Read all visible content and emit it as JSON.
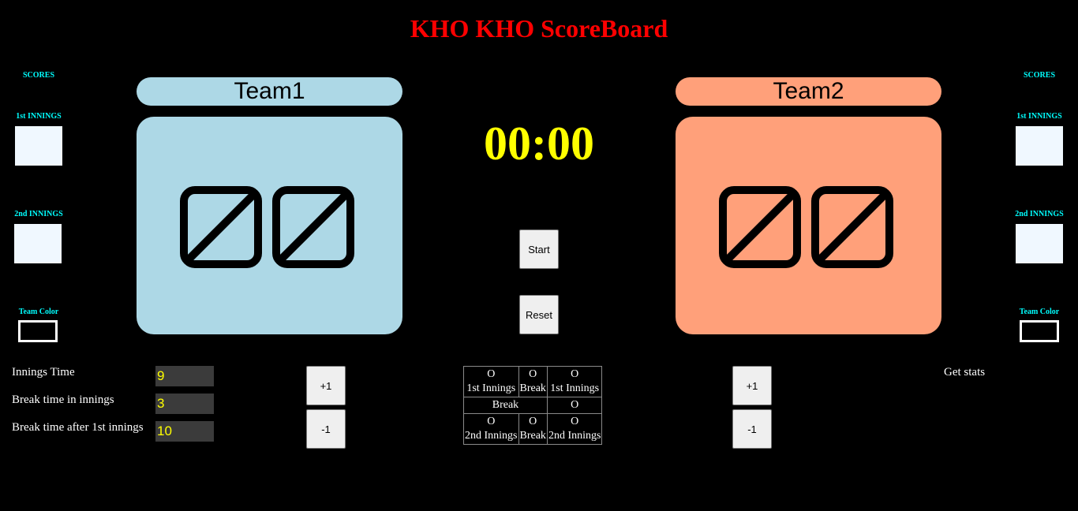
{
  "title": "KHO KHO ScoreBoard",
  "left_panel": {
    "scores_label": "SCORES",
    "first_innings_label": "1st INNINGS",
    "second_innings_label": "2nd INNINGS",
    "team_color_label": "Team Color"
  },
  "right_panel": {
    "scores_label": "SCORES",
    "first_innings_label": "1st INNINGS",
    "second_innings_label": "2nd INNINGS",
    "team_color_label": "Team Color"
  },
  "team1": {
    "name": "Team1",
    "color": "#add8e6",
    "score": "00"
  },
  "team2": {
    "name": "Team2",
    "color": "#ffa07a",
    "score": "00"
  },
  "timer": "00:00",
  "controls": {
    "start_label": "Start",
    "reset_label": "Reset"
  },
  "team1_controls": {
    "plus_label": "+1",
    "minus_label": "-1"
  },
  "team2_controls": {
    "plus_label": "+1",
    "minus_label": "-1"
  },
  "settings": {
    "innings_time_label": "Innings Time",
    "innings_time_value": "9",
    "break_in_innings_label": "Break time in innings",
    "break_in_innings_value": "3",
    "break_after_first_label": "Break time after 1st innings",
    "break_after_first_value": "10"
  },
  "innings_table": {
    "row1": [
      {
        "mark": "O",
        "label": "1st Innings"
      },
      {
        "mark": "O",
        "label": "Break"
      },
      {
        "mark": "O",
        "label": "1st Innings"
      }
    ],
    "row2": {
      "label": "Break",
      "mark": "O"
    },
    "row3": [
      {
        "mark": "O",
        "label": "2nd Innings"
      },
      {
        "mark": "O",
        "label": "Break"
      },
      {
        "mark": "O",
        "label": "2nd Innings"
      }
    ]
  },
  "get_stats_label": "Get stats",
  "colors": {
    "title": "#ff0000",
    "timer": "#ffff00",
    "side_labels": "#00ffff",
    "score_box": "#f0f8ff"
  }
}
